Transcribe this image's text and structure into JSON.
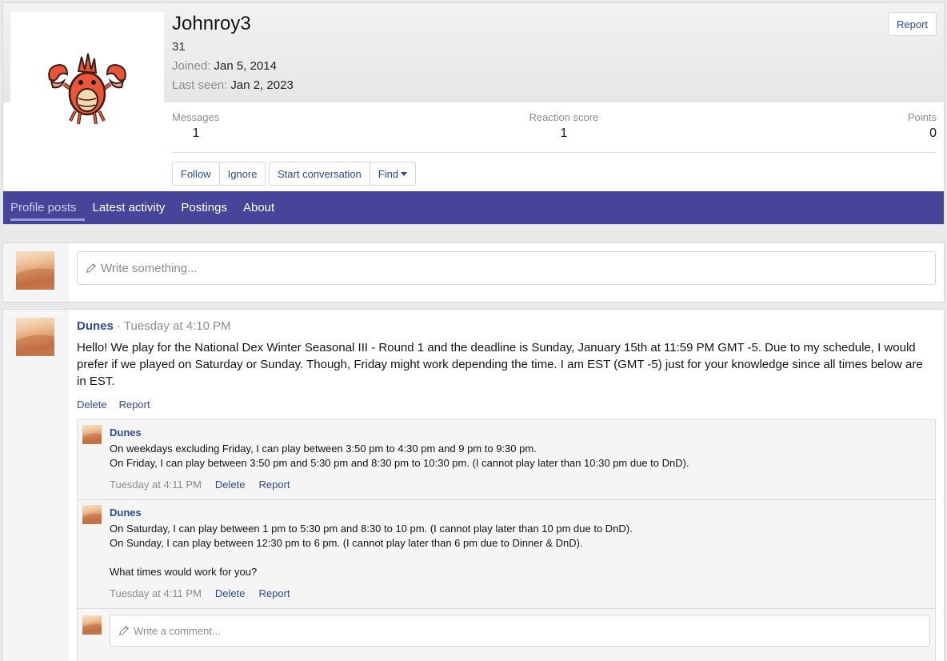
{
  "profile": {
    "username": "Johnroy3",
    "user_title": "31",
    "joined_label": "Joined:",
    "joined_value": "Jan 5, 2014",
    "last_seen_label": "Last seen:",
    "last_seen_value": "Jan 2, 2023",
    "report_label": "Report",
    "stats": {
      "messages_label": "Messages",
      "messages_value": "1",
      "reaction_label": "Reaction score",
      "reaction_value": "1",
      "points_label": "Points",
      "points_value": "0"
    },
    "buttons": {
      "follow": "Follow",
      "ignore": "Ignore",
      "start_conversation": "Start conversation",
      "find": "Find"
    },
    "avatar_icon": "corphish-sprite-icon"
  },
  "tabs": [
    {
      "label": "Profile posts",
      "active": true
    },
    {
      "label": "Latest activity",
      "active": false
    },
    {
      "label": "Postings",
      "active": false
    },
    {
      "label": "About",
      "active": false
    }
  ],
  "new_post": {
    "placeholder": "Write something..."
  },
  "post": {
    "author": "Dunes",
    "separator": "·",
    "time": "Tuesday at 4:10 PM",
    "body": "Hello! We play for the National Dex Winter Seasonal III - Round 1 and the deadline is Sunday, January 15th at 11:59 PM GMT -5. Due to my schedule, I would prefer if we played on Saturday or Sunday. Though, Friday might work depending the time. I am EST (GMT -5) just for your knowledge since all times below are in EST.",
    "delete_label": "Delete",
    "report_label": "Report"
  },
  "comments": [
    {
      "author": "Dunes",
      "lines": [
        "On weekdays excluding Friday, I can play between 3:50 pm to 4:30 pm and 9 pm to 9:30 pm.",
        "On Friday, I can play between 3:50 pm and 5:30 pm and 8:30 pm to 10:30 pm. (I cannot play later than 10:30 pm due to DnD)."
      ],
      "time": "Tuesday at 4:11 PM",
      "delete_label": "Delete",
      "report_label": "Report"
    },
    {
      "author": "Dunes",
      "lines": [
        "On Saturday, I can play between 1 pm to 5:30 pm and 8:30 to 10 pm. (I cannot play later than 10 pm due to DnD).",
        "On Sunday, I can play between 12:30 pm to 6 pm. (I cannot play later than 6 pm due to Dinner & DnD).",
        "",
        "What times would work for you?"
      ],
      "time": "Tuesday at 4:11 PM",
      "delete_label": "Delete",
      "report_label": "Report"
    }
  ],
  "comment_input": {
    "placeholder": "Write a comment..."
  },
  "colors": {
    "accent": "#47459a",
    "link": "#2c4b95"
  }
}
